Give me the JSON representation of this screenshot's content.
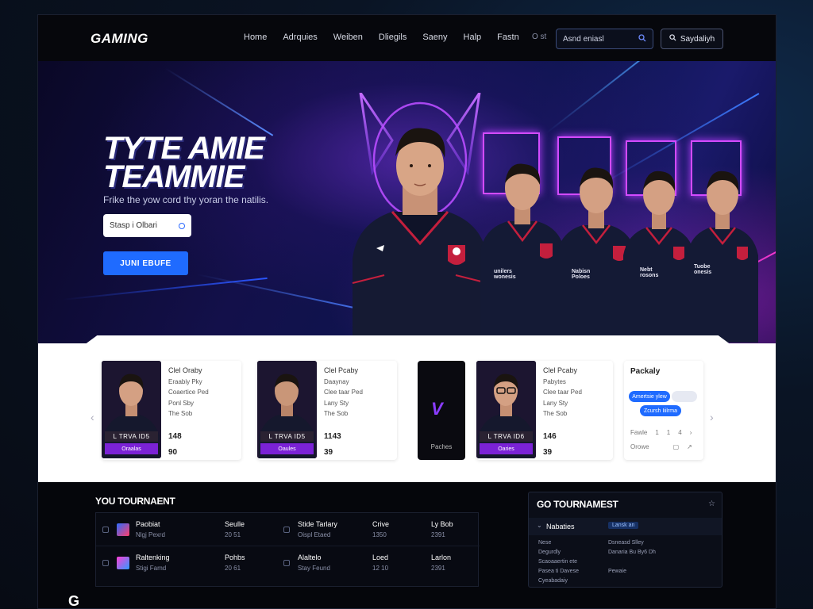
{
  "nav": {
    "logo": "GAMING",
    "links": [
      "Home",
      "Adrquies",
      "Weiben",
      "Dliegils",
      "Saeny",
      "Halp",
      "Fastn"
    ],
    "extra": "O st",
    "search_placeholder": "Asnd eniasl",
    "search_icon": "search-icon",
    "button_label": "Saydaliyh",
    "button_icon": "search-icon"
  },
  "hero": {
    "title_line1": "TYTE AMIE",
    "title_line2": "TEAMMIE",
    "subtitle": "Frike the yow cord thy yoran the natilis.",
    "input_placeholder": "Stasp i Olbari",
    "cta_label": "JUNI EBUFE",
    "jersey_labels": [
      "unilers\nwonesis",
      "Nabisn\nPoloes",
      "Nebt\nrosons",
      "Tuobe\nonesis"
    ]
  },
  "cards": {
    "players": [
      {
        "name": "Clel Oraby",
        "lines": [
          "Eraabiy Pky",
          "Coaertice Ped",
          "Ponl Sby",
          "The Sob"
        ],
        "band": "L  TRVA ID5",
        "tag": "Oraalas",
        "stat1": "148",
        "stat2": "90"
      },
      {
        "name": "Clel Pcaby",
        "lines": [
          "Daaynay",
          "Clee taar Ped",
          "Lany Sty",
          "The Sob"
        ],
        "band": "L  TRVA ID5",
        "tag": "Oaules",
        "stat1": "1143",
        "stat2": "39"
      },
      {
        "name": "Clel Pcaby",
        "lines": [
          "Pabytes",
          "Clee taar Ped",
          "Lany Sty",
          "The Sob"
        ],
        "band": "L  TRVA ID6",
        "tag": "Oaries",
        "stat1": "146",
        "stat2": "39"
      }
    ],
    "dark_card_label": "Paches",
    "pack": {
      "title": "Packaly",
      "pill1": "Amertsie ylew",
      "pill2": "Zcursh Iiilrma",
      "row1_label": "Fawle",
      "row1_vals": [
        "1",
        "1",
        "4"
      ],
      "row2_label": "Orowe"
    }
  },
  "tournament": {
    "title": "YOU TOURNAENT",
    "rows": [
      {
        "c1a": "Paobiat",
        "c1b": "Nlgj Pexrd",
        "c2a": "Seulle",
        "c2b": "20 51",
        "c3a": "Stide Tarlary",
        "c3b": "Oispl Etaed",
        "c4a": "Crive",
        "c4b": "1350",
        "c5a": "Ly Bob",
        "c5b": "2391"
      },
      {
        "c1a": "Raltenking",
        "c1b": "Stigi Famd",
        "c2a": "Pohbs",
        "c2b": "20 61",
        "c3a": "Alaltelo",
        "c3b": "Stay Feund",
        "c4a": "Loed",
        "c4b": "12 10",
        "c5a": "Larlon",
        "c5b": "2391"
      }
    ],
    "panel": {
      "title": "GO TOURNAMEST",
      "head_label": "Nabaties",
      "head_badge": "Lansk an",
      "rows": [
        [
          "Nese",
          "Dsneasd Slley"
        ],
        [
          "Degurdly",
          "Danaria Bu By6 Dh"
        ],
        [
          "Scaoaaertin ete",
          ""
        ],
        [
          "Pasea ti Davese",
          "Pewaie"
        ],
        [
          "Cyeabadaiy",
          ""
        ]
      ]
    }
  },
  "footer_peek": "G"
}
